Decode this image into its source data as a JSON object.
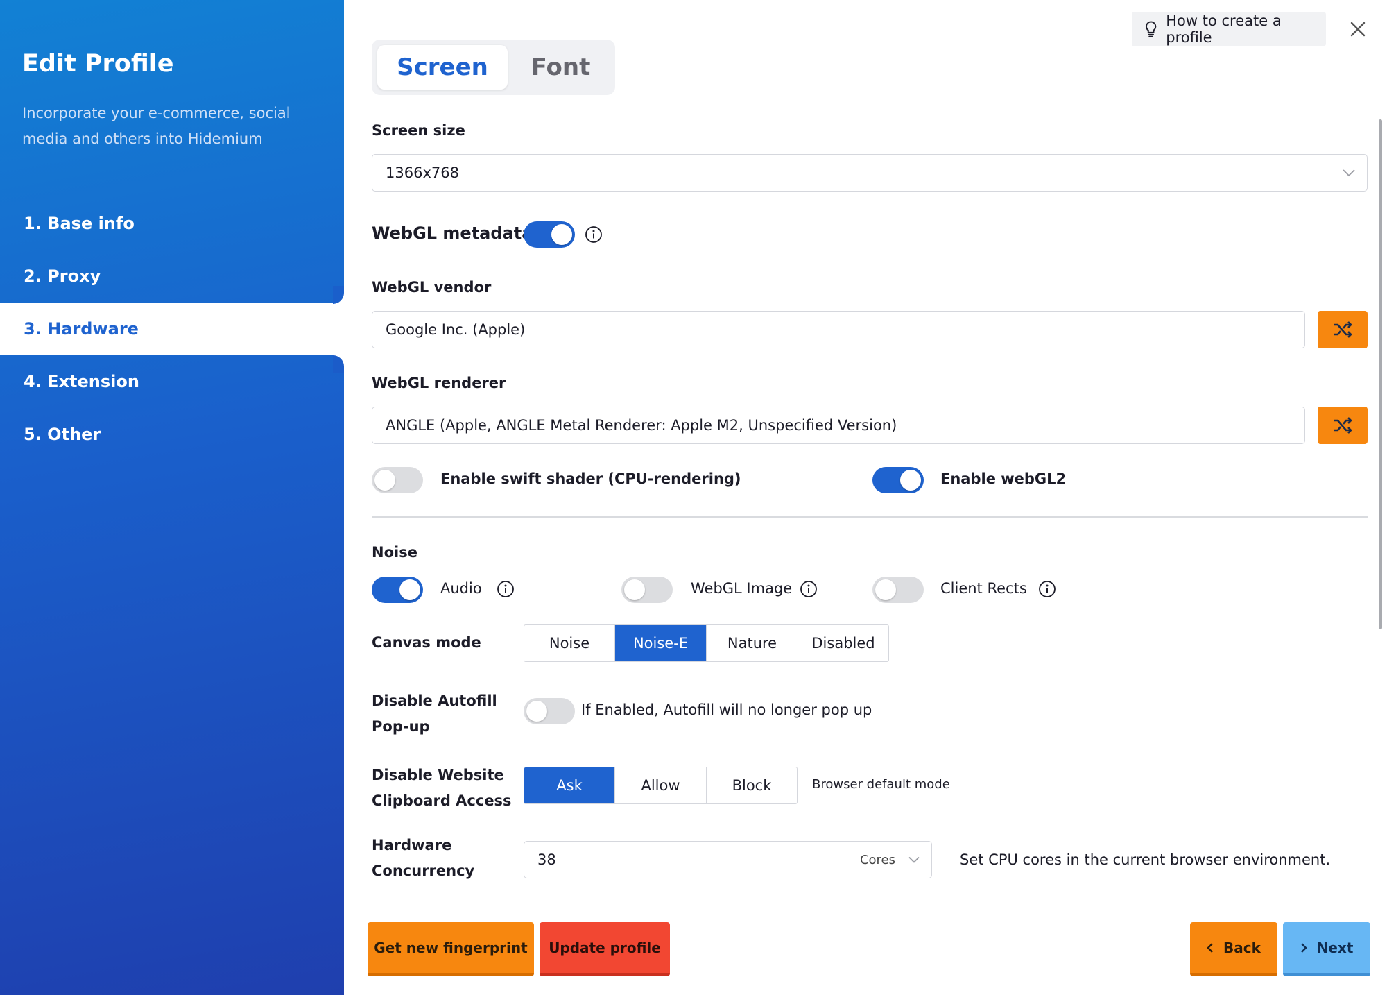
{
  "sidebar": {
    "title": "Edit Profile",
    "subtitle": "Incorporate your e-commerce, social media and others into Hidemium",
    "items": [
      {
        "label": "1. Base info"
      },
      {
        "label": "2. Proxy"
      },
      {
        "label": "3. Hardware"
      },
      {
        "label": "4. Extension"
      },
      {
        "label": "5. Other"
      }
    ],
    "active_index": 2
  },
  "tabs": [
    {
      "label": "Screen"
    },
    {
      "label": "Font"
    }
  ],
  "help": {
    "label": "How to create a profile",
    "icon": "lightbulb-icon"
  },
  "screen_size": {
    "label": "Screen size",
    "value": "1366x768"
  },
  "webgl_metadata": {
    "label": "WebGL metadata",
    "enabled": true
  },
  "webgl_vendor": {
    "label": "WebGL vendor",
    "value": "Google Inc. (Apple)"
  },
  "webgl_renderer": {
    "label": "WebGL renderer",
    "value": "ANGLE (Apple, ANGLE Metal Renderer: Apple M2, Unspecified Version)"
  },
  "swift_shader": {
    "label": "Enable swift shader (CPU-rendering)",
    "enabled": false
  },
  "webgl2": {
    "label": "Enable webGL2",
    "enabled": true
  },
  "noise": {
    "label": "Noise",
    "audio": {
      "label": "Audio",
      "enabled": true
    },
    "webgl_image": {
      "label": "WebGL Image",
      "enabled": false
    },
    "client_rects": {
      "label": "Client Rects",
      "enabled": false
    }
  },
  "canvas_mode": {
    "label": "Canvas mode",
    "options": [
      "Noise",
      "Noise-E",
      "Nature",
      "Disabled"
    ],
    "selected": "Noise-E"
  },
  "autofill": {
    "label_line1": "Disable Autofill",
    "label_line2": "Pop-up",
    "enabled": false,
    "hint": "If Enabled, Autofill will no longer pop up"
  },
  "clipboard": {
    "label_line1": "Disable Website",
    "label_line2": "Clipboard Access",
    "options": [
      "Ask",
      "Allow",
      "Block"
    ],
    "selected": "Ask",
    "hint": "Browser default mode"
  },
  "hardware_concurrency": {
    "label_line1": "Hardware",
    "label_line2": "Concurrency",
    "value": "38",
    "unit": "Cores",
    "hint": "Set CPU cores in the current browser environment."
  },
  "footer": {
    "new_fingerprint": "Get new fingerprint",
    "update_profile": "Update profile",
    "back": "Back",
    "next": "Next"
  },
  "colors": {
    "primary": "#1f63cf",
    "orange": "#f7870f",
    "red": "#f24732",
    "light_blue": "#67b7f4"
  }
}
